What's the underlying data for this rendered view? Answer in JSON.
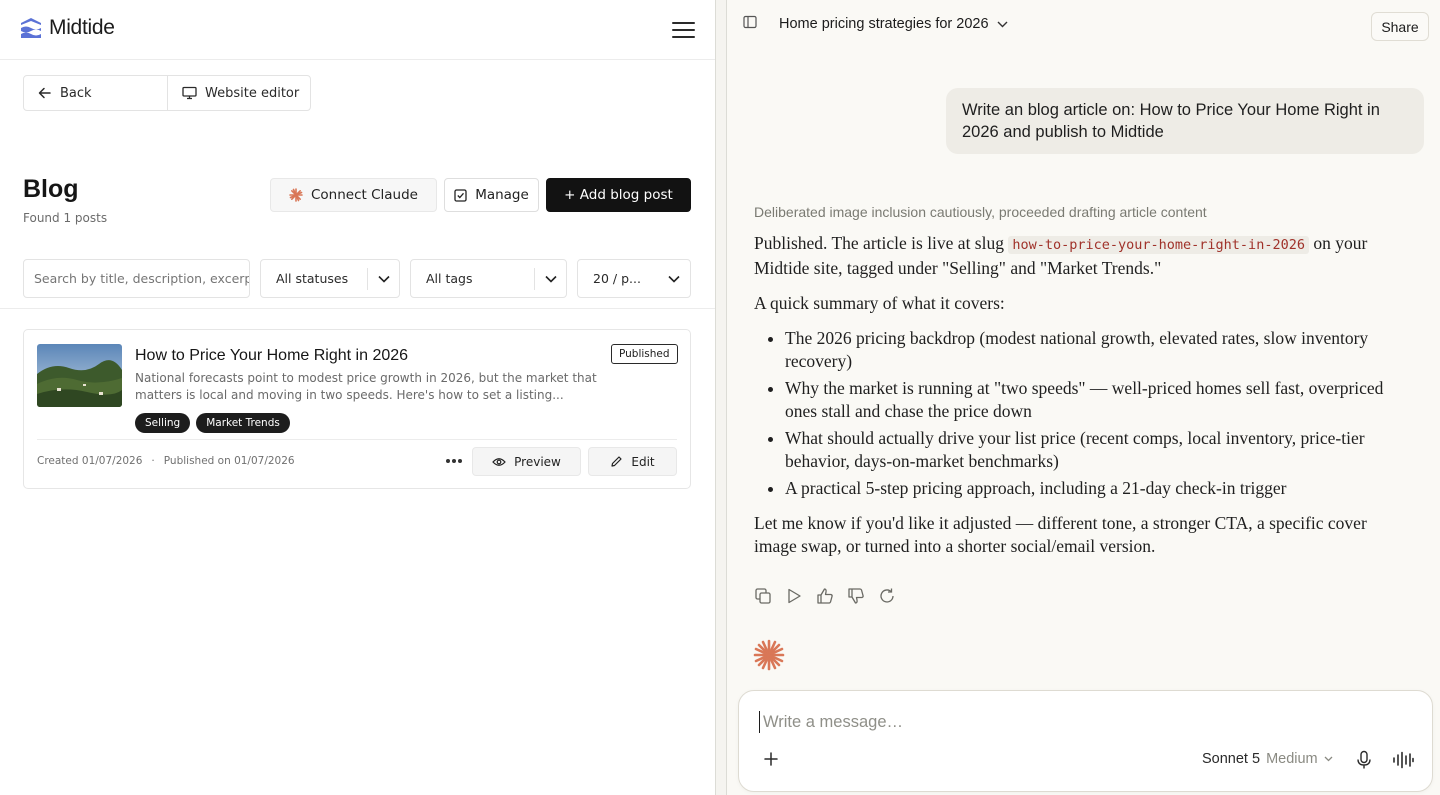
{
  "app": {
    "name": "Midtide"
  },
  "nav": {
    "back_label": "Back",
    "website_editor_label": "Website editor"
  },
  "blog": {
    "title": "Blog",
    "found": "Found 1 posts",
    "connect_label": "Connect Claude",
    "manage_label": "Manage",
    "add_label": "+ Add blog post"
  },
  "filters": {
    "search_placeholder": "Search by title, description, excerpt",
    "status": "All statuses",
    "tags": "All tags",
    "page_size": "20 / p..."
  },
  "post": {
    "title": "How to Price Your Home Right in 2026",
    "excerpt": "National forecasts point to modest price growth in 2026, but the market that matters is local and moving in two speeds. Here's how to set a listing...",
    "status": "Published",
    "tags": [
      "Selling",
      "Market Trends"
    ],
    "created": "Created 01/07/2026",
    "separator": "·",
    "published": "Published on 01/07/2026",
    "preview_label": "Preview",
    "edit_label": "Edit"
  },
  "chat": {
    "title": "Home pricing strategies for 2026",
    "share_label": "Share",
    "user_message": "Write an blog article on: How to Price Your Home Right in 2026 and publish to Midtide",
    "thinking": "Deliberated image inclusion cautiously, proceeded drafting article content",
    "p1_before": "Published. The article is live at slug ",
    "slug": "how-to-price-your-home-right-in-2026",
    "p1_after": " on your Midtide site, tagged under \"Selling\" and \"Market Trends.\"",
    "summary_intro": "A quick summary of what it covers:",
    "bullets": [
      "The 2026 pricing backdrop (modest national growth, elevated rates, slow inventory recovery)",
      "Why the market is running at \"two speeds\" — well-priced homes sell fast, overpriced ones stall and chase the price down",
      "What should actually drive your list price (recent comps, local inventory, price-tier behavior, days-on-market benchmarks)",
      "A practical 5-step pricing approach, including a 21-day check-in trigger"
    ],
    "closing": "Let me know if you'd like it adjusted — different tone, a stronger CTA, a specific cover image swap, or turned into a shorter social/email version.",
    "composer_placeholder": "Write a message…",
    "model_name": "Sonnet 5",
    "model_effort": "Medium"
  },
  "colors": {
    "accent_spark": "#d97757",
    "logo_blue": "#5b72d6",
    "button_dark": "#121212",
    "slug_text": "#a0322a",
    "chat_bg": "#faf9f5"
  },
  "icons": [
    "logo-icon",
    "menu-icon",
    "arrow-left-icon",
    "monitor-icon",
    "claude-spark-icon",
    "checkbox-icon",
    "chevron-down-icon",
    "more-icon",
    "eye-icon",
    "pencil-icon",
    "sidebar-icon",
    "copy-icon",
    "play-icon",
    "thumbs-up-icon",
    "thumbs-down-icon",
    "retry-icon",
    "plus-icon",
    "mic-icon",
    "voice-icon"
  ]
}
